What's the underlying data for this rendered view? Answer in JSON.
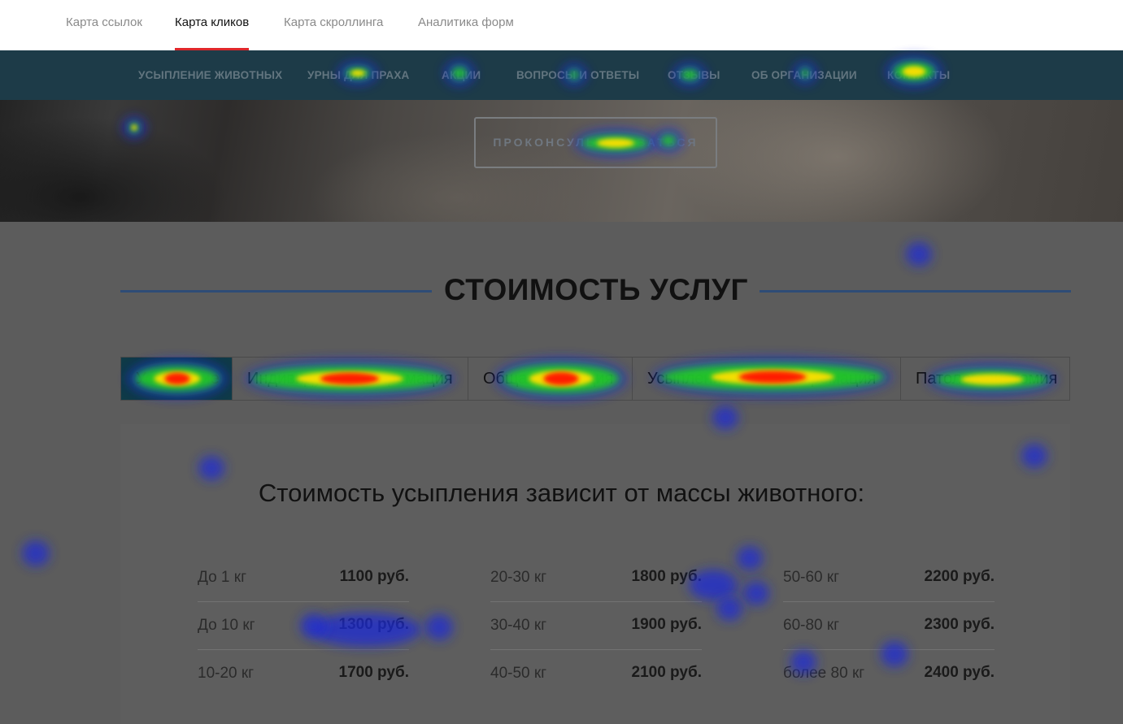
{
  "analytics_tabs": [
    {
      "label": "Карта ссылок",
      "active": false
    },
    {
      "label": "Карта кликов",
      "active": true
    },
    {
      "label": "Карта скроллинга",
      "active": false
    },
    {
      "label": "Аналитика форм",
      "active": false
    }
  ],
  "site_nav": [
    "УСЫПЛЕНИЕ ЖИВОТНЫХ",
    "УРНЫ ДЛЯ ПРАХА",
    "АКЦИИ",
    "ВОПРОСЫ И ОТВЕТЫ",
    "ОТЗЫВЫ",
    "ОБ ОРГАНИЗАЦИИ",
    "КОНТАКТЫ"
  ],
  "hero": {
    "consult_button": "ПРОКОНСУЛЬТИРОВАТЬСЯ"
  },
  "services": {
    "title": "СТОИМОСТЬ УСЛУГ",
    "tabs": [
      {
        "label": "Усыпление",
        "active": true
      },
      {
        "label": "Индивидуальная кремация",
        "active": false
      },
      {
        "label": "Общая кремация",
        "active": false
      },
      {
        "label": "Усыпление + общая кремация",
        "active": false
      },
      {
        "label": "Патологоанатомия",
        "active": false
      }
    ],
    "panel_title": "Стоимость усыпления зависит от массы животного:",
    "prices": [
      [
        {
          "weight": "До 1 кг",
          "price": "1100 руб."
        },
        {
          "weight": "До 10 кг",
          "price": "1300 руб."
        },
        {
          "weight": "10-20 кг",
          "price": "1700 руб."
        }
      ],
      [
        {
          "weight": "20-30 кг",
          "price": "1800 руб."
        },
        {
          "weight": "30-40 кг",
          "price": "1900 руб."
        },
        {
          "weight": "40-50 кг",
          "price": "2100 руб."
        }
      ],
      [
        {
          "weight": "50-60 кг",
          "price": "2200 руб."
        },
        {
          "weight": "60-80 кг",
          "price": "2300 руб."
        },
        {
          "weight": "более 80 кг",
          "price": "2400 руб."
        }
      ]
    ]
  },
  "colors": {
    "active_tab_underline": "#e0272b",
    "nav_background": "#1d3b48",
    "accent_line": "#2e4c76",
    "heat_low": "#1f2bd6",
    "heat_mid": "#22d11f",
    "heat_high": "#ffe000",
    "heat_peak": "#ff1a00"
  }
}
